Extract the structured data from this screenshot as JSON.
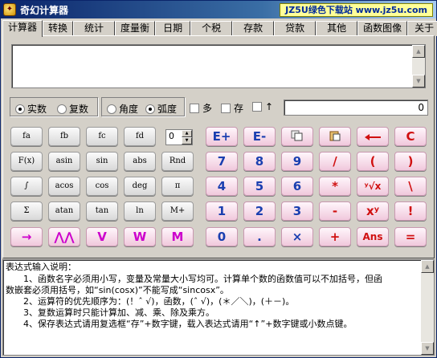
{
  "window": {
    "title": "奇幻计算器",
    "watermark": "JZ5U绿色下载站 www.jz5u.com"
  },
  "tabs": [
    "计算器",
    "转换",
    "统计",
    "度量衡",
    "日期",
    "个税",
    "存款",
    "贷款",
    "其他",
    "函数图像",
    "关于"
  ],
  "expression": {
    "value": ""
  },
  "modes": {
    "number_type": [
      {
        "label": "实数",
        "selected": true
      },
      {
        "label": "复数",
        "selected": false
      }
    ],
    "angle": [
      {
        "label": "角度",
        "selected": false
      },
      {
        "label": "弧度",
        "selected": true
      }
    ],
    "checkboxes": [
      {
        "label": "多"
      },
      {
        "label": "存"
      },
      {
        "label": "↑"
      }
    ]
  },
  "result": {
    "value": "0"
  },
  "spinner": {
    "value": "0"
  },
  "function_keys": {
    "row1": [
      "fa",
      "fb",
      "fc",
      "fd"
    ],
    "row2": [
      "F(x)",
      "asin",
      "sin",
      "abs",
      "Rnd"
    ],
    "row3": [
      "∫",
      "acos",
      "cos",
      "deg",
      "π"
    ],
    "row4": [
      "Σ",
      "atan",
      "tan",
      "ln",
      "M+"
    ],
    "row5": [
      "→",
      "⋀⋀",
      "V",
      "W",
      "M"
    ]
  },
  "number_keys": {
    "row1": [
      "E+",
      "E-",
      "copy-icon",
      "paste-icon",
      "backspace-icon",
      "C"
    ],
    "row2": [
      "7",
      "8",
      "9",
      "/",
      "(",
      ")"
    ],
    "row3": [
      "4",
      "5",
      "6",
      "*",
      "ʸ√x",
      "\\"
    ],
    "row4": [
      "1",
      "2",
      "3",
      "-",
      "xʸ",
      "!"
    ],
    "row5": [
      "0",
      ".",
      "×",
      "+",
      "Ans",
      "="
    ]
  },
  "help": {
    "lines": [
      "表达式输入说明：",
      "　　1、函数名字必须用小写，变量及常量大小写均可。计算单个数的函数值可以不加括号，但函",
      "数嵌套必须用括号，如“sin(cosx)”不能写成“sincosx”。",
      "　　2、运算符的优先顺序为：(！ˆ √)，函数，(ˆ √)，(＊／＼)，(＋－)。",
      "　　3、复数运算时只能计算加、减、乘、除及乘方。",
      "　　4、保存表达式请用复选框“存”+数字键，载入表达式请用“↑”+数字键或小数点键。"
    ]
  },
  "colors": {
    "accent": "#0a246a",
    "blue_keys": "#1a3fb0",
    "red_keys": "#d01010",
    "magenta_keys": "#cc00cc"
  }
}
